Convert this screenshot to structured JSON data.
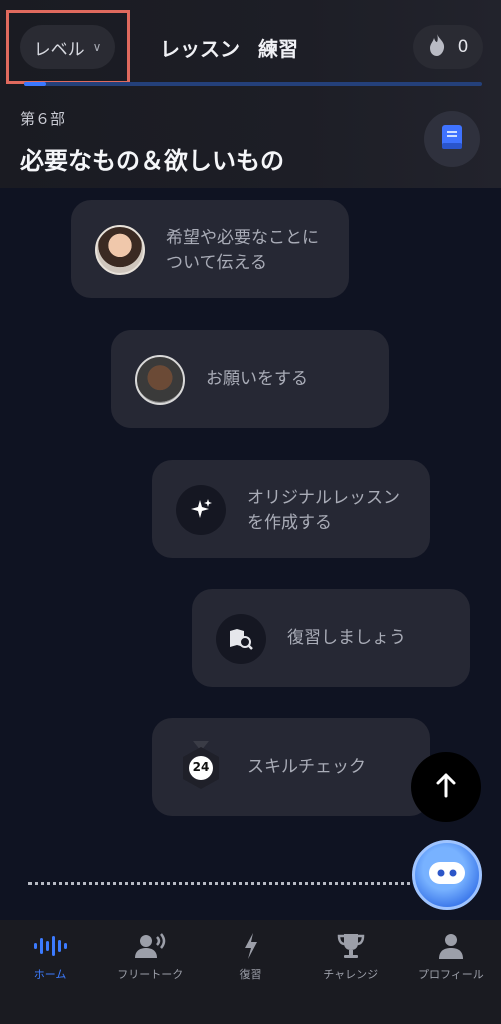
{
  "header": {
    "level_label": "レベル",
    "tabs": [
      "レッスン",
      "練習"
    ],
    "streak_count": "0",
    "section_label": "第６部",
    "section_title": "必要なもの＆欲しいもの"
  },
  "lessons": [
    {
      "line1": "希望や必要なことに",
      "line2": "ついて伝える",
      "icon": "avatar-woman"
    },
    {
      "line1": "お願いをする",
      "line2": "",
      "icon": "avatar-man"
    },
    {
      "line1": "オリジナルレッスン",
      "line2": "を作成する",
      "icon": "sparkle-icon"
    },
    {
      "line1": "復習しましょう",
      "line2": "",
      "icon": "review-icon"
    },
    {
      "line1": "スキルチェック",
      "line2": "",
      "icon": "badge-icon",
      "badge_number": "24"
    }
  ],
  "bottom_nav": [
    {
      "label": "ホーム",
      "icon": "waveform-icon",
      "active": true
    },
    {
      "label": "フリートーク",
      "icon": "speaking-person-icon",
      "active": false
    },
    {
      "label": "復習",
      "icon": "lightning-icon",
      "active": false
    },
    {
      "label": "チャレンジ",
      "icon": "trophy-icon",
      "active": false
    },
    {
      "label": "プロフィール",
      "icon": "person-icon",
      "active": false
    }
  ],
  "colors": {
    "accent": "#3c7bff",
    "highlight": "#e06a5e"
  }
}
